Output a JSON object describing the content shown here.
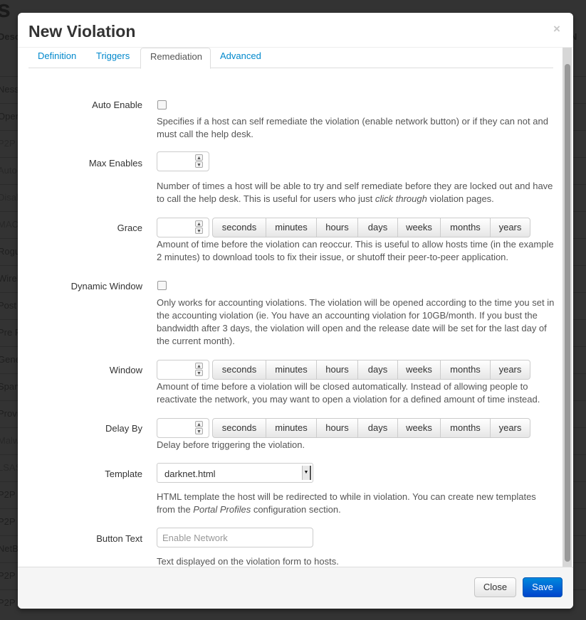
{
  "background_page": {
    "title_fragment": "s",
    "column_header_left": "Desc",
    "column_header_right": "N",
    "rows": [
      "Ness",
      "Open",
      "P2P",
      "Auto-",
      "Disab",
      "MAC",
      "Rogu",
      "Wirel",
      "Post",
      "Pre F",
      "Gene",
      "Spam",
      "Provi",
      "Malw",
      "LSAS",
      "P2P",
      "P2P",
      "NetB",
      "P2P",
      "P2P"
    ]
  },
  "modal": {
    "title": "New Violation",
    "close_glyph": "×",
    "tabs": [
      {
        "label": "Definition",
        "active": false
      },
      {
        "label": "Triggers",
        "active": false
      },
      {
        "label": "Remediation",
        "active": true
      },
      {
        "label": "Advanced",
        "active": false
      }
    ],
    "units": [
      "seconds",
      "minutes",
      "hours",
      "days",
      "weeks",
      "months",
      "years"
    ],
    "fields": {
      "auto_enable": {
        "label": "Auto Enable",
        "checked": false,
        "help": "Specifies if a host can self remediate the violation (enable network button) or if they can not and must call the help desk."
      },
      "max_enables": {
        "label": "Max Enables",
        "value": "",
        "help_before": "Number of times a host will be able to try and self remediate before they are locked out and have to call the help desk. This is useful for users who just ",
        "help_em": "click through",
        "help_after": " violation pages."
      },
      "grace": {
        "label": "Grace",
        "value": "",
        "help": "Amount of time before the violation can reoccur. This is useful to allow hosts time (in the example 2 minutes) to download tools to fix their issue, or shutoff their peer-to-peer application."
      },
      "dynamic_window": {
        "label": "Dynamic Window",
        "checked": false,
        "help": "Only works for accounting violations. The violation will be opened according to the time you set in the accounting violation (ie. You have an accounting violation for 10GB/month. If you bust the bandwidth after 3 days, the violation will open and the release date will be set for the last day of the current month)."
      },
      "window": {
        "label": "Window",
        "value": "",
        "help": "Amount of time before a violation will be closed automatically. Instead of allowing people to reactivate the network, you may want to open a violation for a defined amount of time instead."
      },
      "delay_by": {
        "label": "Delay By",
        "value": "",
        "help": "Delay before triggering the violation."
      },
      "template": {
        "label": "Template",
        "selected": "darknet.html",
        "help_before": "HTML template the host will be redirected to while in violation. You can create new templates from the ",
        "help_em": "Portal Profiles",
        "help_after": " configuration section."
      },
      "button_text": {
        "label": "Button Text",
        "value": "",
        "placeholder": "Enable Network",
        "help": "Text displayed on the violation form to hosts."
      }
    },
    "footer": {
      "close_label": "Close",
      "save_label": "Save"
    }
  },
  "colors": {
    "link": "#0088cc",
    "primary": "#0066cc",
    "backdrop": "#333333"
  }
}
